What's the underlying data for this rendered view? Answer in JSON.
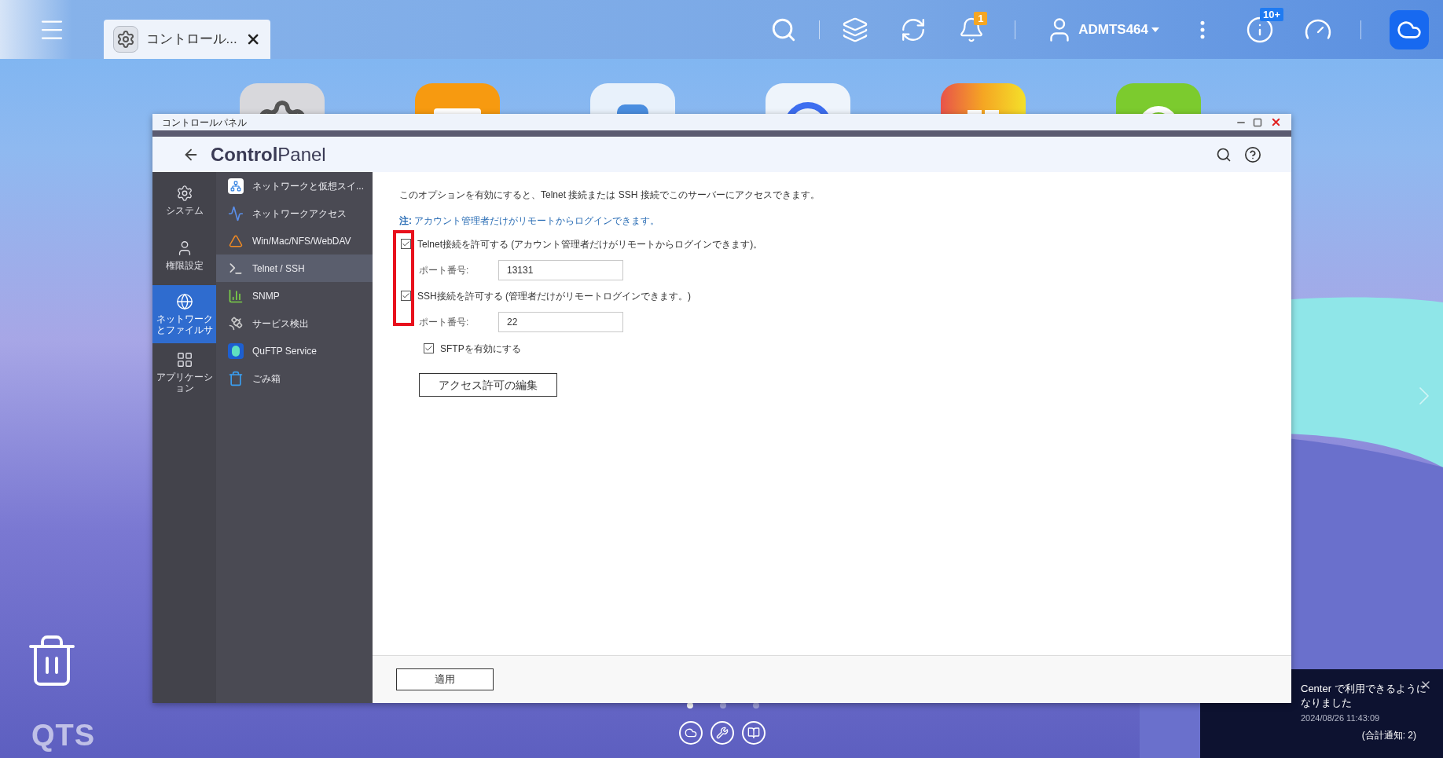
{
  "top_bar": {
    "tab": {
      "label": "コントロール..."
    },
    "bell_badge": "1",
    "user": "ADMTS464",
    "info_badge": "10+"
  },
  "desktop_label": "QTS",
  "window": {
    "title": "コントロールパネル",
    "heading": "**Control**Panel",
    "rail": [
      {
        "label": "システム",
        "kind": "gear",
        "selected": false
      },
      {
        "label": "権限設定",
        "kind": "user",
        "selected": false
      },
      {
        "label": "ネットワークとファイルサ",
        "kind": "globe",
        "selected": true
      },
      {
        "label": "アプリケーション",
        "kind": "apps",
        "selected": false
      }
    ],
    "menu": [
      {
        "label": "ネットワークと仮想スイ...",
        "kind": "switch",
        "selected": false
      },
      {
        "label": "ネットワークアクセス",
        "kind": "wave",
        "selected": false
      },
      {
        "label": "Win/Mac/NFS/WebDAV",
        "kind": "triangle",
        "selected": false
      },
      {
        "label": "Telnet / SSH",
        "kind": "terminal",
        "selected": true
      },
      {
        "label": "SNMP",
        "kind": "bars",
        "selected": false
      },
      {
        "label": "サービス検出",
        "kind": "dish",
        "selected": false
      },
      {
        "label": "QuFTP Service",
        "kind": "ftp",
        "selected": false
      },
      {
        "label": "ごみ箱",
        "kind": "trash",
        "selected": false
      }
    ],
    "content": {
      "intro": "このオプションを有効にすると、Telnet 接続または SSH 接続でこのサーバーにアクセスできます。",
      "note": "**注:** アカウント管理者だけがリモートからログインできます。",
      "options": [
        {
          "kind": "checkbox",
          "label": "Telnet接続を許可する (アカウント管理者だけがリモートからログインできます)。",
          "checked": true
        },
        {
          "kind": "port",
          "label": "ポート番号:",
          "value": "13131"
        },
        {
          "kind": "checkbox",
          "label": "SSH接続を許可する (管理者だけがリモートログインできます。)",
          "checked": true
        },
        {
          "kind": "port",
          "label": "ポート番号:",
          "value": "22"
        },
        {
          "kind": "sub_checkbox",
          "label": "SFTPを有効にする",
          "checked": true
        },
        {
          "kind": "button",
          "label": "アクセス許可の編集"
        }
      ]
    },
    "apply_button": "適用"
  },
  "notification": {
    "message": "Center で利用できるようになりました",
    "time": "2024/08/26 11:43:09",
    "total": "(合計通知: 2)"
  },
  "pager": [
    {
      "selected": true
    },
    {
      "selected": false
    },
    {
      "selected": false
    }
  ]
}
